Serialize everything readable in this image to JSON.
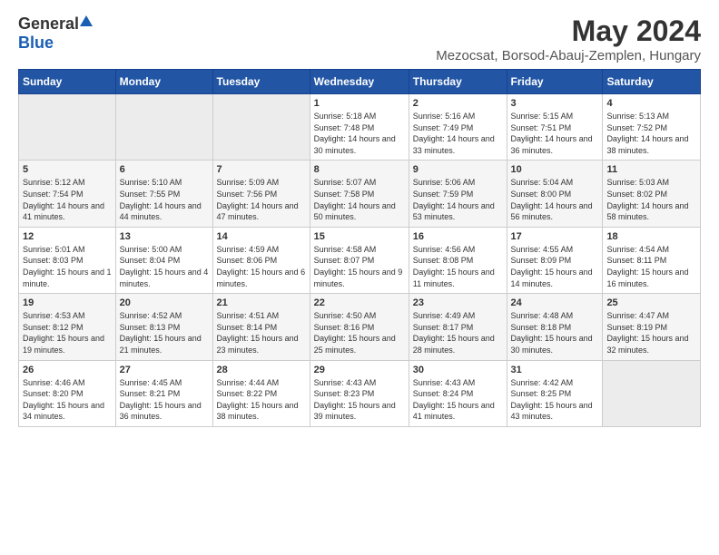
{
  "header": {
    "logo_general": "General",
    "logo_blue": "Blue",
    "month": "May 2024",
    "location": "Mezocsat, Borsod-Abauj-Zemplen, Hungary"
  },
  "days_of_week": [
    "Sunday",
    "Monday",
    "Tuesday",
    "Wednesday",
    "Thursday",
    "Friday",
    "Saturday"
  ],
  "weeks": [
    [
      {
        "day": "",
        "empty": true
      },
      {
        "day": "",
        "empty": true
      },
      {
        "day": "",
        "empty": true
      },
      {
        "day": "1",
        "sunrise": "5:18 AM",
        "sunset": "7:48 PM",
        "daylight": "14 hours and 30 minutes."
      },
      {
        "day": "2",
        "sunrise": "5:16 AM",
        "sunset": "7:49 PM",
        "daylight": "14 hours and 33 minutes."
      },
      {
        "day": "3",
        "sunrise": "5:15 AM",
        "sunset": "7:51 PM",
        "daylight": "14 hours and 36 minutes."
      },
      {
        "day": "4",
        "sunrise": "5:13 AM",
        "sunset": "7:52 PM",
        "daylight": "14 hours and 38 minutes."
      }
    ],
    [
      {
        "day": "5",
        "sunrise": "5:12 AM",
        "sunset": "7:54 PM",
        "daylight": "14 hours and 41 minutes."
      },
      {
        "day": "6",
        "sunrise": "5:10 AM",
        "sunset": "7:55 PM",
        "daylight": "14 hours and 44 minutes."
      },
      {
        "day": "7",
        "sunrise": "5:09 AM",
        "sunset": "7:56 PM",
        "daylight": "14 hours and 47 minutes."
      },
      {
        "day": "8",
        "sunrise": "5:07 AM",
        "sunset": "7:58 PM",
        "daylight": "14 hours and 50 minutes."
      },
      {
        "day": "9",
        "sunrise": "5:06 AM",
        "sunset": "7:59 PM",
        "daylight": "14 hours and 53 minutes."
      },
      {
        "day": "10",
        "sunrise": "5:04 AM",
        "sunset": "8:00 PM",
        "daylight": "14 hours and 56 minutes."
      },
      {
        "day": "11",
        "sunrise": "5:03 AM",
        "sunset": "8:02 PM",
        "daylight": "14 hours and 58 minutes."
      }
    ],
    [
      {
        "day": "12",
        "sunrise": "5:01 AM",
        "sunset": "8:03 PM",
        "daylight": "15 hours and 1 minute."
      },
      {
        "day": "13",
        "sunrise": "5:00 AM",
        "sunset": "8:04 PM",
        "daylight": "15 hours and 4 minutes."
      },
      {
        "day": "14",
        "sunrise": "4:59 AM",
        "sunset": "8:06 PM",
        "daylight": "15 hours and 6 minutes."
      },
      {
        "day": "15",
        "sunrise": "4:58 AM",
        "sunset": "8:07 PM",
        "daylight": "15 hours and 9 minutes."
      },
      {
        "day": "16",
        "sunrise": "4:56 AM",
        "sunset": "8:08 PM",
        "daylight": "15 hours and 11 minutes."
      },
      {
        "day": "17",
        "sunrise": "4:55 AM",
        "sunset": "8:09 PM",
        "daylight": "15 hours and 14 minutes."
      },
      {
        "day": "18",
        "sunrise": "4:54 AM",
        "sunset": "8:11 PM",
        "daylight": "15 hours and 16 minutes."
      }
    ],
    [
      {
        "day": "19",
        "sunrise": "4:53 AM",
        "sunset": "8:12 PM",
        "daylight": "15 hours and 19 minutes."
      },
      {
        "day": "20",
        "sunrise": "4:52 AM",
        "sunset": "8:13 PM",
        "daylight": "15 hours and 21 minutes."
      },
      {
        "day": "21",
        "sunrise": "4:51 AM",
        "sunset": "8:14 PM",
        "daylight": "15 hours and 23 minutes."
      },
      {
        "day": "22",
        "sunrise": "4:50 AM",
        "sunset": "8:16 PM",
        "daylight": "15 hours and 25 minutes."
      },
      {
        "day": "23",
        "sunrise": "4:49 AM",
        "sunset": "8:17 PM",
        "daylight": "15 hours and 28 minutes."
      },
      {
        "day": "24",
        "sunrise": "4:48 AM",
        "sunset": "8:18 PM",
        "daylight": "15 hours and 30 minutes."
      },
      {
        "day": "25",
        "sunrise": "4:47 AM",
        "sunset": "8:19 PM",
        "daylight": "15 hours and 32 minutes."
      }
    ],
    [
      {
        "day": "26",
        "sunrise": "4:46 AM",
        "sunset": "8:20 PM",
        "daylight": "15 hours and 34 minutes."
      },
      {
        "day": "27",
        "sunrise": "4:45 AM",
        "sunset": "8:21 PM",
        "daylight": "15 hours and 36 minutes."
      },
      {
        "day": "28",
        "sunrise": "4:44 AM",
        "sunset": "8:22 PM",
        "daylight": "15 hours and 38 minutes."
      },
      {
        "day": "29",
        "sunrise": "4:43 AM",
        "sunset": "8:23 PM",
        "daylight": "15 hours and 39 minutes."
      },
      {
        "day": "30",
        "sunrise": "4:43 AM",
        "sunset": "8:24 PM",
        "daylight": "15 hours and 41 minutes."
      },
      {
        "day": "31",
        "sunrise": "4:42 AM",
        "sunset": "8:25 PM",
        "daylight": "15 hours and 43 minutes."
      },
      {
        "day": "",
        "empty": true
      }
    ]
  ]
}
